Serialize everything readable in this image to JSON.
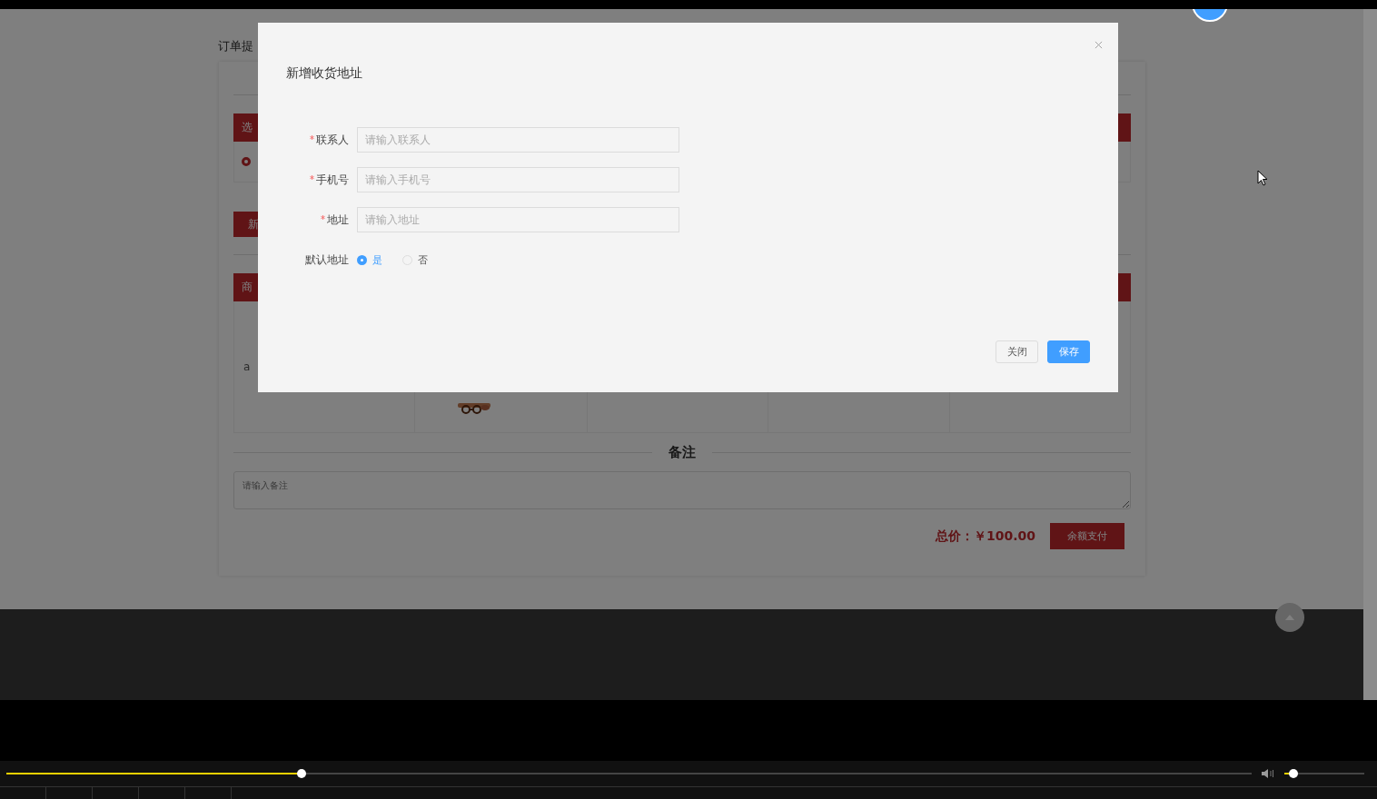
{
  "page": {
    "breadcrumb": "订单提",
    "address_header": "选",
    "address_radio": {
      "selected": true
    },
    "new_address_button": "新",
    "goods_header": "商",
    "goods_row": {
      "column_1": "a"
    },
    "remarks_title": "备注",
    "remarks": {
      "placeholder": "请输入备注"
    },
    "total": "总价：￥100.00",
    "pay_button": "余额支付"
  },
  "dialog": {
    "title": "新增收货地址",
    "fields": [
      {
        "label": "联系人",
        "required": true,
        "placeholder": "请输入联系人"
      },
      {
        "label": "手机号",
        "required": true,
        "placeholder": "请输入手机号"
      },
      {
        "label": "地址",
        "required": true,
        "placeholder": "请输入地址"
      }
    ],
    "default_address": {
      "label": "默认地址",
      "options": [
        {
          "label": "是",
          "selected": true
        },
        {
          "label": "否",
          "selected": false
        }
      ]
    },
    "buttons": [
      {
        "label": "关闭",
        "kind": "default"
      },
      {
        "label": "保存",
        "kind": "primary"
      }
    ]
  },
  "player": {
    "progress": {
      "level": 0.237
    },
    "volume": {
      "level": 0.11
    }
  }
}
